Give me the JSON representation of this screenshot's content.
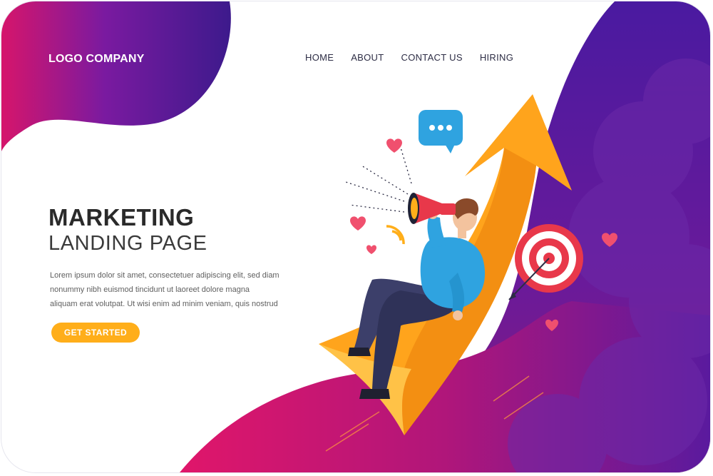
{
  "brand": {
    "logo_text": "LOGO COMPANY"
  },
  "nav": {
    "items": [
      {
        "label": "HOME"
      },
      {
        "label": "ABOUT"
      },
      {
        "label": "CONTACT US"
      },
      {
        "label": "HIRING"
      }
    ]
  },
  "hero": {
    "title": "MARKETING",
    "subtitle": "LANDING PAGE",
    "body_lines": [
      "Lorem ipsum dolor sit amet, consectetuer adipiscing elit, sed diam",
      "nonummy nibh euismod tincidunt ut laoreet dolore magna",
      "aliquam erat volutpat. Ut wisi enim ad minim veniam, quis nostrud"
    ],
    "cta_label": "GET STARTED"
  },
  "icons": {
    "chat": "speech-bubble-icon",
    "megaphone": "megaphone-icon",
    "target": "target-icon",
    "hearts": "heart-icon",
    "arrow": "growth-arrow-icon"
  },
  "colors": {
    "magenta": "#d6156b",
    "purple": "#5a1a9e",
    "deep_purple": "#3d1a8c",
    "orange": "#ffae1a",
    "blue": "#2fa3e0",
    "red": "#e8384a",
    "pink_heart": "#f0506e"
  }
}
